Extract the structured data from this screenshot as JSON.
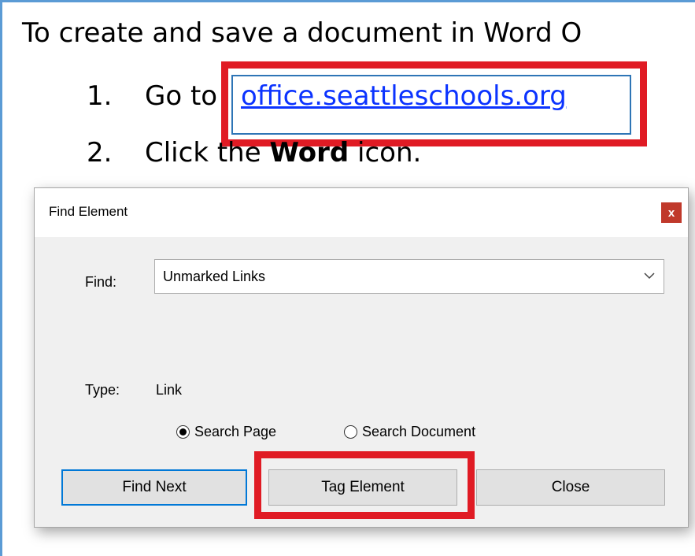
{
  "document": {
    "heading": "To create and save a document in Word O",
    "step1_number": "1.",
    "step1_prefix": "Go to",
    "step1_link": "office.seattleschools.org",
    "step2_number": "2.",
    "step2_prefix": "Click the",
    "step2_bold": "Word",
    "step2_suffix": "icon."
  },
  "dialog": {
    "title": "Find Element",
    "close_glyph": "x",
    "find_label": "Find:",
    "find_value": "Unmarked Links",
    "type_label": "Type:",
    "type_value": "Link",
    "radio_options": [
      "Search Page",
      "Search Document"
    ],
    "selected_radio": "Search Page",
    "buttons": {
      "find_next": "Find Next",
      "tag_element": "Tag Element",
      "close": "Close"
    }
  },
  "icons": {
    "dropdown": "chevron-down-icon",
    "close": "close-icon"
  },
  "colors": {
    "frame_border": "#5b9bd5",
    "highlight": "#e01b24",
    "link": "#0b33ff",
    "link_box": "#2e75b6",
    "close_button": "#c0392b",
    "focus_border": "#0078d7"
  }
}
